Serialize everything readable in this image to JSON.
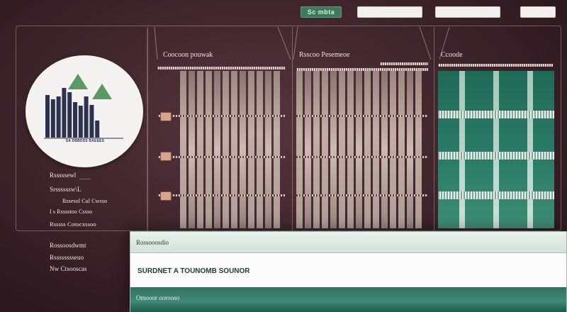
{
  "topbar": {
    "green_button_label": "Sc mbta",
    "input1_value": "",
    "input2_value": "",
    "input3_value": ""
  },
  "logo": {
    "caption": "SA DBBDSS BAEEES",
    "bar_heights": [
      60,
      54,
      58,
      70,
      64,
      50,
      45,
      58,
      46,
      24
    ],
    "colors": {
      "bars": "#2d3250",
      "triangles": "#5b9a63"
    }
  },
  "sidebar": {
    "items": [
      {
        "label": "Rsssssewl"
      },
      {
        "label": "Srssssssw\\L"
      },
      {
        "label": "Rssesol Cul Cwsso"
      },
      {
        "label": "I s Rsssstoo Cssso"
      },
      {
        "label": "Rsssss Cotocxssoo"
      },
      {
        "label": "Rossoosdwmt"
      },
      {
        "label": "Rsssssssseuo"
      },
      {
        "label": "Nw Ctsooscas"
      }
    ]
  },
  "panels": [
    {
      "title": "Coocoon pouwak"
    },
    {
      "title": "Rsscoo Pesemeoe"
    },
    {
      "title": "Ccoode"
    }
  ],
  "dialog": {
    "header": "Rossooosdio",
    "body": "SURDNET A TOUNOMB SOUNOR",
    "footer": "Omooor oorooso"
  },
  "colors": {
    "background": "#4a2b34",
    "accent_green": "#2b7d67",
    "panel_columns": "#cbbab0"
  }
}
